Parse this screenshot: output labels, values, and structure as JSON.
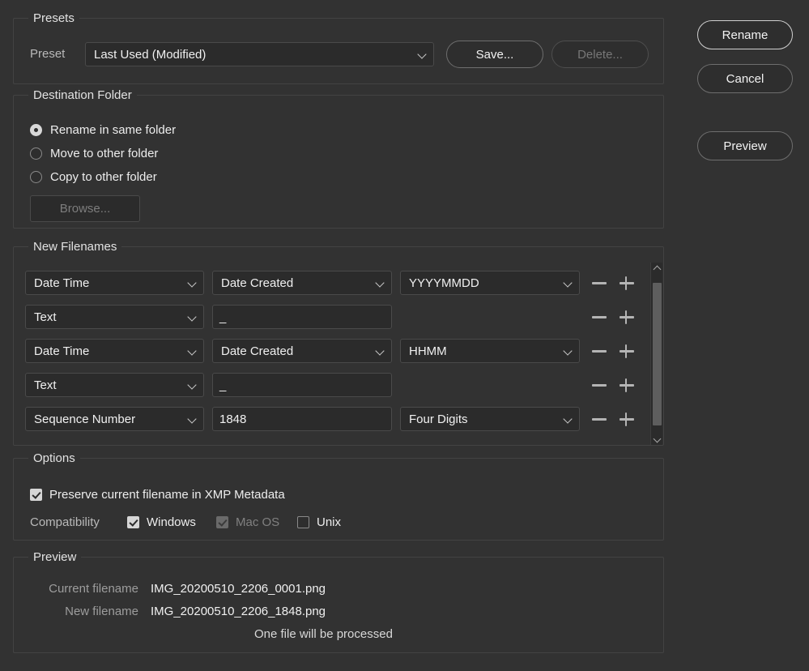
{
  "presets": {
    "group_label": "Presets",
    "preset_label": "Preset",
    "preset_value": "Last Used (Modified)",
    "save_button": "Save...",
    "delete_button": "Delete..."
  },
  "destination": {
    "group_label": "Destination Folder",
    "options": [
      {
        "label": "Rename in same folder",
        "selected": true
      },
      {
        "label": "Move to other folder",
        "selected": false
      },
      {
        "label": "Copy to other folder",
        "selected": false
      }
    ],
    "browse_button": "Browse..."
  },
  "new_filenames": {
    "group_label": "New Filenames",
    "rows": [
      {
        "type": "Date Time",
        "field": "Date Created",
        "format": "YYYYMMDD",
        "kind": "select"
      },
      {
        "type": "Text",
        "field": "_",
        "format": "",
        "kind": "text"
      },
      {
        "type": "Date Time",
        "field": "Date Created",
        "format": "HHMM",
        "kind": "select"
      },
      {
        "type": "Text",
        "field": "_",
        "format": "",
        "kind": "text"
      },
      {
        "type": "Sequence Number",
        "field": "1848",
        "format": "Four Digits",
        "kind": "text"
      }
    ],
    "remove_label": "minus-icon",
    "add_label": "plus-icon"
  },
  "options": {
    "group_label": "Options",
    "preserve": {
      "label": "Preserve current filename in XMP Metadata",
      "checked": true
    },
    "compatibility_label": "Compatibility",
    "compatibility": [
      {
        "label": "Windows",
        "checked": true,
        "disabled": false
      },
      {
        "label": "Mac OS",
        "checked": true,
        "disabled": true
      },
      {
        "label": "Unix",
        "checked": false,
        "disabled": false
      }
    ]
  },
  "preview": {
    "group_label": "Preview",
    "current_label": "Current filename",
    "current_value": "IMG_20200510_2206_0001.png",
    "new_label": "New filename",
    "new_value": "IMG_20200510_2206_1848.png",
    "note": "One file will be processed"
  },
  "actions": {
    "rename": "Rename",
    "cancel": "Cancel",
    "preview": "Preview"
  },
  "colors": {
    "window_bg": "#323232",
    "field_bg": "#2b2b2b",
    "border": "#4a4a4a",
    "group_border": "#434343",
    "text": "#f0f0f0",
    "muted_text": "#9d9d9d",
    "disabled_text": "#777777",
    "default_button_border": "#cfcfcf"
  }
}
